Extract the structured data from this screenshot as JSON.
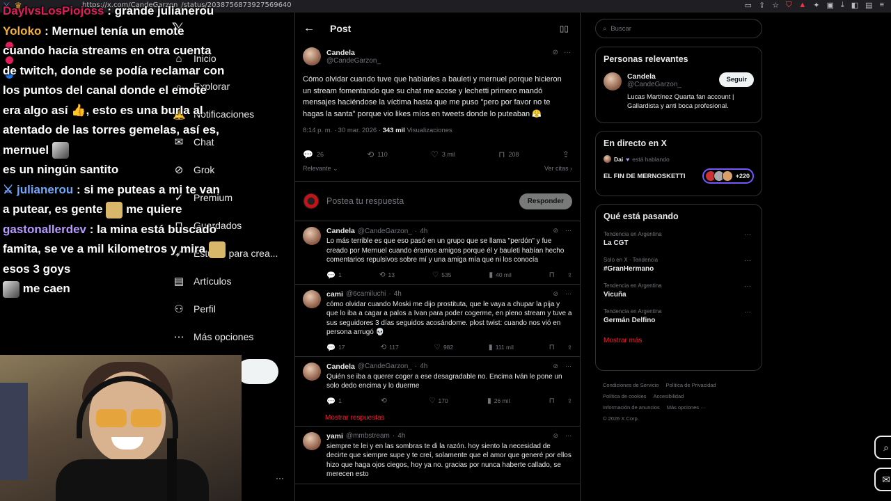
{
  "browser": {
    "url": "https://x.com/CandeGarzon_/status/2038756873927569640"
  },
  "nav": {
    "items": [
      {
        "label": "Inicio",
        "icon": "home-icon",
        "glyph": "⌂"
      },
      {
        "label": "Explorar",
        "icon": "search-icon",
        "glyph": "⌕"
      },
      {
        "label": "Notificaciones",
        "icon": "bell-icon",
        "glyph": "🔔"
      },
      {
        "label": "Chat",
        "icon": "chat-icon",
        "glyph": "✉"
      },
      {
        "label": "Grok",
        "icon": "grok-icon",
        "glyph": "⊘"
      },
      {
        "label": "Premium",
        "icon": "premium-icon",
        "glyph": "✓"
      },
      {
        "label": "Guardados",
        "icon": "bookmark-icon",
        "glyph": "⊓"
      },
      {
        "label": "Estudio para crea...",
        "icon": "rocket-icon",
        "glyph": "➶"
      },
      {
        "label": "Artículos",
        "icon": "article-icon",
        "glyph": "▤"
      },
      {
        "label": "Perfil",
        "icon": "profile-icon",
        "glyph": "⚇"
      },
      {
        "label": "Más opciones",
        "icon": "more-icon",
        "glyph": "⋯"
      }
    ]
  },
  "header": {
    "title": "Post"
  },
  "main_post": {
    "name": "Candela",
    "handle": "@CandeGarzon_",
    "text": "Cómo olvidar cuando tuve que hablarles a bauleti y mernuel porque hicieron un stream fomentando que su chat me acose y lechetti primero mandó mensajes haciéndose la víctima hasta que me puso \"pero por favor no te hagas la santa\" porque vio likes míos en tweets donde lo puteaban 😤",
    "time": "8:14 p. m. · 30 mar. 2026 ·",
    "views": "343 mil",
    "views_label": "Visualizaciones",
    "replies": "26",
    "reposts": "110",
    "likes": "3 mil",
    "bookmarks": "208",
    "sort": "Relevante",
    "quotes": "Ver citas"
  },
  "reply": {
    "placeholder": "Postea tu respuesta",
    "button": "Responder"
  },
  "replies": [
    {
      "name": "Candela",
      "handle": "@CandeGarzon_",
      "time": "4h",
      "text": "Lo más terrible es que eso pasó en un grupo que se llama \"perdón\" y fue creado por Mernuel cuando éramos amigos porque él y bauleti habían hecho comentarios repulsivos sobre mí y una amiga mía que ni los conocía",
      "replies": "1",
      "reposts": "13",
      "likes": "535",
      "views": "40 mil"
    },
    {
      "name": "cami",
      "handle": "@6camiluchi",
      "time": "4h",
      "text": "cómo olvidar cuando Moski me dijo prostituta, que le vaya a chupar la pija y que lo iba a cagar a palos a Ivan para poder cogerme, en pleno stream y tuve a sus seguidores 3 días seguidos acosándome. plost twist: cuando nos vió en persona arrugó 💀",
      "replies": "17",
      "reposts": "117",
      "likes": "982",
      "views": "111 mil"
    },
    {
      "name": "Candela",
      "handle": "@CandeGarzon_",
      "time": "4h",
      "text": "Quién se iba a querer coger a ese desagradable no. Encima Iván le pone un solo dedo encima y lo duerme",
      "replies": "1",
      "reposts": "",
      "likes": "170",
      "views": "26 mil",
      "show_more": "Mostrar respuestas"
    },
    {
      "name": "yami",
      "handle": "@mmbstream",
      "time": "4h",
      "text": "siempre te lei y en las sombras te di la razón. hoy siento la necesidad de decirte que siempre supe y te creí, solamente que el amor que generé por ellos hizo que haga ojos ciegos, hoy ya no. gracias por nunca haberte callado, se merecen esto"
    }
  ],
  "search": {
    "placeholder": "Buscar"
  },
  "relevant": {
    "title": "Personas relevantes",
    "name": "Candela",
    "handle": "@CandeGarzon_",
    "follow": "Seguir",
    "bio": "Lucas Martínez Quarta fan account | Gallardista y anti boca profesional."
  },
  "live": {
    "title": "En directo en X",
    "host": "Dai",
    "status": "está hablando",
    "space": "EL FIN DE MERNOSKETTI",
    "count": "+220"
  },
  "trends": {
    "title": "Qué está pasando",
    "items": [
      {
        "context": "Tendencia en Argentina",
        "topic": "La CGT"
      },
      {
        "context": "Solo en X · Tendencia",
        "topic": "#GranHermano"
      },
      {
        "context": "Tendencia en Argentina",
        "topic": "Vicuña"
      },
      {
        "context": "Tendencia en Argentina",
        "topic": "Germán Delfino"
      }
    ],
    "more": "Mostrar más"
  },
  "footer": {
    "links": [
      "Condiciones de Servicio",
      "Política de Privacidad",
      "Política de cookies",
      "Accesibilidad",
      "Información de anuncios",
      "Más opciones ···"
    ],
    "copyright": "© 2026 X Corp."
  },
  "chat": [
    {
      "user": "DaylvsLosPiojoss",
      "text": ": grande julianerou"
    },
    {
      "user": "Yoloko",
      "text": ": Mernuel tenía un emote cuando hacía streams en otra cuenta de twitch, donde se podía reclamar con los puntos del canal donde el emote era algo así 👍, esto es una burla al atentado de las torres gemelas, así es, mernuel",
      "text2": "es un ningún santito"
    },
    {
      "user": "julianerou",
      "text": ": si me puteas a mi te van a putear, es gente",
      "text2": "me quiere"
    },
    {
      "user": "gastonallerdev",
      "text": ": la mina está buscado famita, se ve a mil kilometros y mira",
      "text2": "esos 3 goys",
      "text3": "me caen"
    }
  ]
}
